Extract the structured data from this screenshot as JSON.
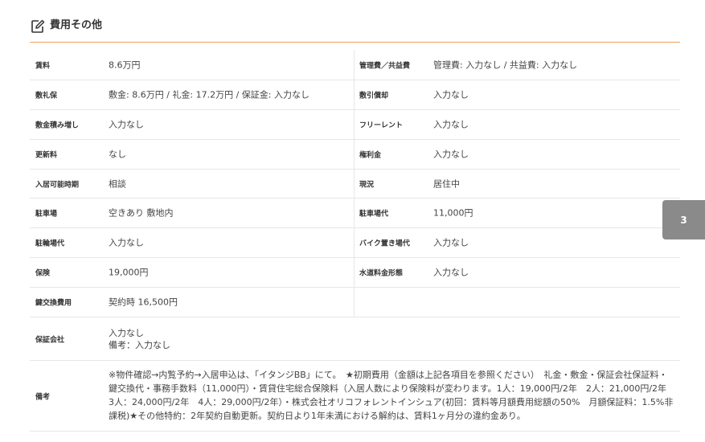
{
  "section": {
    "title": "費用その他",
    "icon": "edit-square-icon"
  },
  "rows": [
    {
      "left": {
        "label": "賃料",
        "value": "8.6万円"
      },
      "right": {
        "label": "管理費／共益費",
        "value": "管理費: 入力なし / 共益費: 入力なし"
      }
    },
    {
      "left": {
        "label": "敷礼保",
        "value": "敷金: 8.6万円 / 礼金: 17.2万円 / 保証金: 入力なし"
      },
      "right": {
        "label": "敷引償却",
        "value": "入力なし"
      }
    },
    {
      "left": {
        "label": "敷金積み増し",
        "value": "入力なし"
      },
      "right": {
        "label": "フリーレント",
        "value": "入力なし"
      }
    },
    {
      "left": {
        "label": "更新料",
        "value": "なし"
      },
      "right": {
        "label": "権利金",
        "value": "入力なし"
      }
    },
    {
      "left": {
        "label": "入居可能時期",
        "value": "相談"
      },
      "right": {
        "label": "現況",
        "value": "居住中"
      }
    },
    {
      "left": {
        "label": "駐車場",
        "value": "空きあり 敷地内"
      },
      "right": {
        "label": "駐車場代",
        "value": "11,000円"
      }
    },
    {
      "left": {
        "label": "駐輪場代",
        "value": "入力なし"
      },
      "right": {
        "label": "バイク置き場代",
        "value": "入力なし"
      }
    },
    {
      "left": {
        "label": "保険",
        "value": "19,000円"
      },
      "right": {
        "label": "水道料金形態",
        "value": "入力なし"
      }
    },
    {
      "left": {
        "label": "鍵交換費用",
        "value": "契約時 16,500円"
      }
    }
  ],
  "guarantor": {
    "label": "保証会社",
    "line1": "入力なし",
    "line2": "備考：入力なし"
  },
  "remarks": {
    "label": "備考",
    "text": "※物件確認→内覧予約→入居申込は、「イタンジBB」にて。　★初期費用（金額は上記各項目を参照ください）　礼金・敷金・保証会社保証料・鍵交換代・事務手数料（11,000円）・賃貸住宅総合保険料（入居人数により保険料が変わります。1人：19,000円/2年　2人：21,000円/2年　3人：24,000円/2年　4人：29,000円/2年）・株式会社オリコフォレントインシュア(初回：賃料等月額費用総額の50%　月額保証料：1.5%非課税)★その他特約：2年契約自動更新。契約日より1年未満における解約は、賃料1ヶ月分の違約金あり。"
  },
  "side_tab": {
    "label": "3"
  },
  "colors": {
    "accent_line": "#f0a25a",
    "divider": "#e6e6e6",
    "tab_bg": "#8a8a8a"
  }
}
